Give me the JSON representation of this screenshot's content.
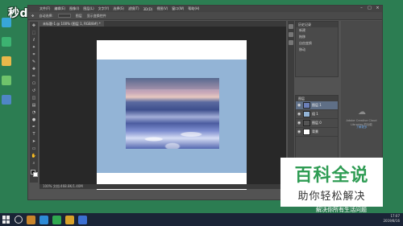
{
  "desktop": {
    "watermark_top": "秒dong视频",
    "icon_colors": [
      "#38a6d8",
      "#3cb371",
      "#e8b84a",
      "#6fc36b",
      "#4f86c6"
    ]
  },
  "photoshop": {
    "menus": [
      "文件(F)",
      "编辑(E)",
      "图像(I)",
      "图层(L)",
      "文字(Y)",
      "选择(S)",
      "滤镜(T)",
      "3D(D)",
      "视图(V)",
      "窗口(W)",
      "帮助(H)"
    ],
    "options": [
      "自动选择:",
      "图层",
      "显示变换控件"
    ],
    "doc_tab": "未标题-1 @ 100% (图层 1, RGB/8#) *",
    "status": "100%  文档:468.8K/1.40M",
    "tools": [
      "move-icon",
      "marquee-icon",
      "lasso-icon",
      "magic-wand-icon",
      "crop-icon",
      "eyedropper-icon",
      "healing-icon",
      "brush-icon",
      "stamp-icon",
      "history-brush-icon",
      "eraser-icon",
      "gradient-icon",
      "blur-icon",
      "dodge-icon",
      "pen-icon",
      "type-icon",
      "path-select-icon",
      "shape-icon",
      "hand-icon",
      "zoom-icon"
    ],
    "tool_glyphs": [
      "✥",
      "⬚",
      "ℓ",
      "✦",
      "⌗",
      "✎",
      "✚",
      "✏",
      "⎔",
      "↺",
      "◫",
      "▤",
      "◔",
      "●",
      "✒",
      "T",
      "➤",
      "▭",
      "✋",
      "⌕"
    ],
    "history": {
      "title": "历史记录",
      "rows": [
        "新建",
        "拖移",
        "自由变换",
        "移动"
      ]
    },
    "layers": {
      "title": "图层",
      "rows": [
        {
          "name": "图层 1",
          "selected": true
        },
        {
          "name": "组 1",
          "selected": false
        },
        {
          "name": "图层 0",
          "selected": false
        },
        {
          "name": "背景",
          "selected": false
        }
      ]
    },
    "creative_cloud": {
      "text": "Adobe Creative Cloud Libraries 的功能",
      "link": "了解更多"
    }
  },
  "watermark": {
    "main": "百科全说",
    "sub": "助你轻松解决",
    "bottom": "解决你所有生活问题"
  },
  "taskbar": {
    "time": "17:07",
    "date": "2019/8/16",
    "app_colors": [
      "#c9852b",
      "#2e8bd6",
      "#2fa84f",
      "#d9a22a",
      "#3c6fd1"
    ]
  }
}
